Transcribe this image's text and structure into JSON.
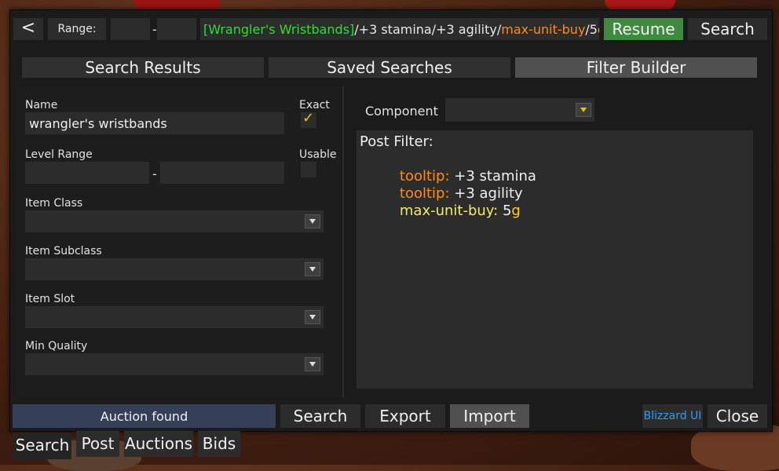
{
  "colors": {
    "green_text": "#2de02d",
    "orange_text": "#ff8c1a",
    "gold_text": "#ffd21a",
    "yellow_text": "#f4e86a",
    "resume_bg": "#3f8a3f",
    "status_bg": "#354058",
    "blizzard_blue": "#2f9cf0"
  },
  "icons": {
    "back": "chevron-left-icon",
    "dropdown": "dropdown-arrow-icon",
    "checkbox": "checkmark-icon"
  },
  "topbar": {
    "back_label": "<",
    "range_label": "Range:",
    "range_min": "",
    "range_sep": "-",
    "range_max": "",
    "query": {
      "item": "[Wrangler's Wristbands]",
      "sep1": "/",
      "part2": "+3 stamina",
      "sep2": "/",
      "part3": "+3 agility",
      "sep3": "/",
      "part4": "max-unit-buy",
      "sep4": "/",
      "part5_num": "5",
      "part5_unit": "g"
    },
    "resume_label": "Resume",
    "search_label": "Search"
  },
  "tabs": [
    "Search Results",
    "Saved Searches",
    "Filter Builder"
  ],
  "form": {
    "name_label": "Name",
    "name_value": "wrangler's wristbands",
    "exact_label": "Exact",
    "exact_checked": true,
    "level_label": "Level Range",
    "level_sep": "-",
    "usable_label": "Usable",
    "usable_checked": false,
    "item_class_label": "Item Class",
    "item_subclass_label": "Item Subclass",
    "item_slot_label": "Item Slot",
    "min_quality_label": "Min Quality"
  },
  "component": {
    "label": "Component",
    "value": ""
  },
  "post_filter": {
    "title": "Post Filter:",
    "lines": [
      {
        "key": "tooltip:",
        "value": " +3 stamina"
      },
      {
        "key": "tooltip:",
        "value": " +3 agility"
      },
      {
        "key": "max-unit-buy:",
        "value": " 5",
        "unit": "g"
      }
    ]
  },
  "footer": {
    "status": "Auction found",
    "search_label": "Search",
    "export_label": "Export",
    "import_label": "Import",
    "blizzard_label": "Blizzard UI",
    "close_label": "Close"
  },
  "bottom_tabs": [
    "Search",
    "Post",
    "Auctions",
    "Bids"
  ]
}
